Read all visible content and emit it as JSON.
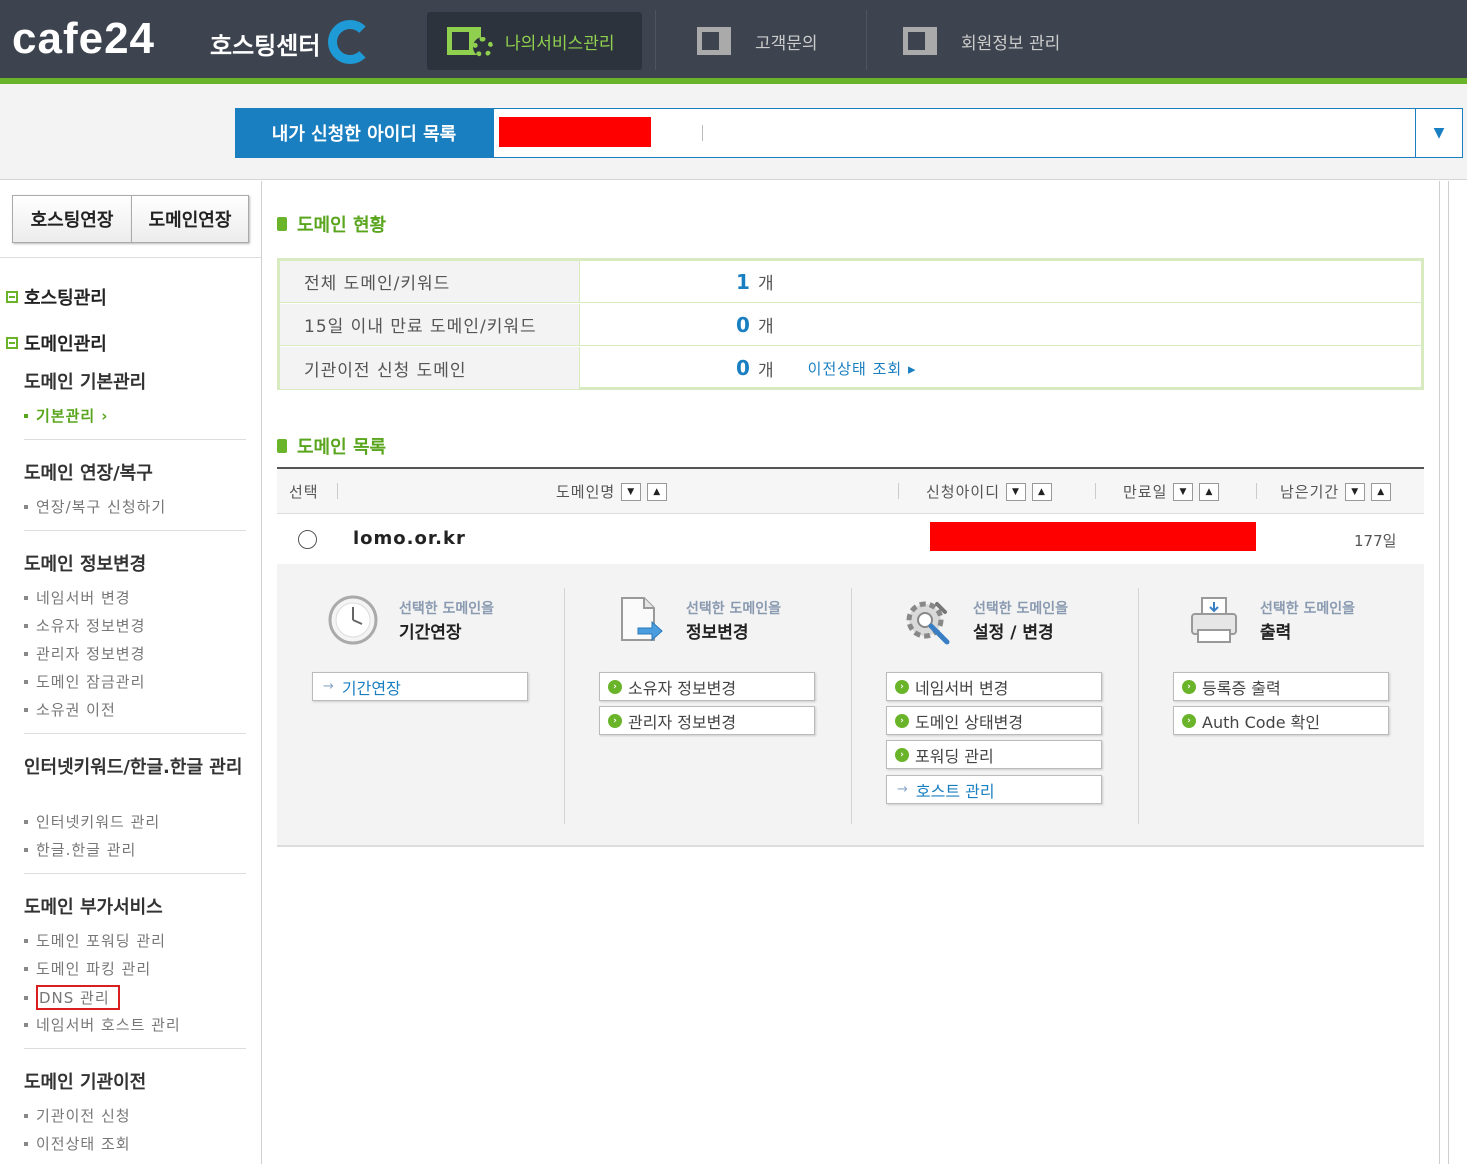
{
  "header": {
    "logo": "cafe24",
    "logo_sub": "호스팅센터",
    "nav": [
      {
        "label": "나의서비스관리",
        "active": true
      },
      {
        "label": "고객문의",
        "active": false
      },
      {
        "label": "회원정보 관리",
        "active": false
      }
    ]
  },
  "idbar": {
    "label": "내가 신청한 아이디 목록",
    "dropdown_icon": "chevron-down-icon"
  },
  "sidebar": {
    "renew_hosting": "호스팅연장",
    "renew_domain": "도메인연장",
    "categories": [
      "호스팅관리",
      "도메인관리"
    ],
    "groups": [
      {
        "title": "도메인 기본관리",
        "items": [
          "기본관리"
        ]
      },
      {
        "title": "도메인 연장/복구",
        "items": [
          "연장/복구 신청하기"
        ]
      },
      {
        "title": "도메인 정보변경",
        "items": [
          "네임서버 변경",
          "소유자 정보변경",
          "관리자 정보변경",
          "도메인 잠금관리",
          "소유권 이전"
        ]
      },
      {
        "title": "인터넷키워드/한글.한글 관리",
        "items": [
          "인터넷키워드 관리",
          "한글.한글 관리"
        ]
      },
      {
        "title": "도메인 부가서비스",
        "items": [
          "도메인 포워딩 관리",
          "도메인 파킹 관리",
          "DNS 관리",
          "네임서버 호스트 관리"
        ]
      },
      {
        "title": "도메인 기관이전",
        "items": [
          "기관이전 신청",
          "이전상태 조회"
        ]
      }
    ]
  },
  "status": {
    "title": "도메인 현황",
    "rows": [
      {
        "label": "전체 도메인/키워드",
        "count": "1",
        "unit": "개"
      },
      {
        "label": "15일 이내 만료 도메인/키워드",
        "count": "0",
        "unit": "개"
      },
      {
        "label": "기관이전 신청 도메인",
        "count": "0",
        "unit": "개",
        "link": "이전상태 조회 ▸"
      }
    ]
  },
  "domain_list": {
    "title": "도메인 목록",
    "columns": {
      "select": "선택",
      "name": "도메인명",
      "id": "신청아이디",
      "expiry": "만료일",
      "remaining": "남은기간"
    },
    "rows": [
      {
        "name": "lomo.or.kr",
        "remaining": "177일"
      }
    ]
  },
  "actions": {
    "columns": [
      {
        "small": "선택한 도메인을",
        "large": "기간연장",
        "icon": "clock-icon",
        "buttons": [
          {
            "label": "기간연장",
            "style": "arrow"
          }
        ]
      },
      {
        "small": "선택한 도메인을",
        "large": "정보변경",
        "icon": "document-arrow-icon",
        "buttons": [
          {
            "label": "소유자 정보변경",
            "style": "dot"
          },
          {
            "label": "관리자 정보변경",
            "style": "dot"
          }
        ]
      },
      {
        "small": "선택한 도메인을",
        "large": "설정 / 변경",
        "icon": "settings-gear-icon",
        "buttons": [
          {
            "label": "네임서버 변경",
            "style": "dot"
          },
          {
            "label": "도메인 상태변경",
            "style": "dot"
          },
          {
            "label": "포워딩 관리",
            "style": "dot"
          },
          {
            "label": "호스트 관리",
            "style": "arrow"
          }
        ]
      },
      {
        "small": "선택한 도메인을",
        "large": "출력",
        "icon": "printer-icon",
        "buttons": [
          {
            "label": "등록증 출력",
            "style": "dot"
          },
          {
            "label": "Auth Code 확인",
            "style": "dot"
          }
        ]
      }
    ]
  },
  "colors": {
    "brand_green": "#6ab42a",
    "brand_blue": "#1a7fc1",
    "header_bg": "#3d444f",
    "highlight_red": "#d81e1e"
  }
}
